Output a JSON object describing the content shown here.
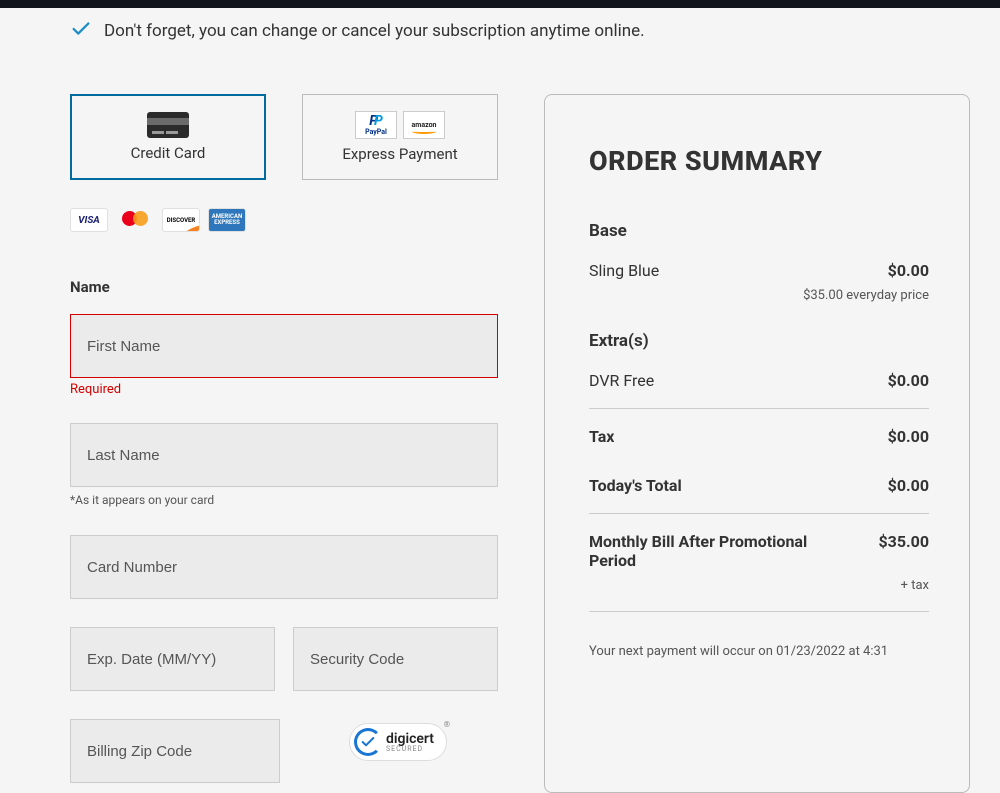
{
  "reminder": {
    "text": "Don't forget, you can change or cancel your subscription anytime online."
  },
  "payment_methods": {
    "credit_card": {
      "label": "Credit Card"
    },
    "express": {
      "label": "Express Payment"
    },
    "paypal_text": "PayPal",
    "amazon_text": "amazon"
  },
  "card_brands": {
    "visa": "VISA",
    "mastercard_hint": "mastercard",
    "discover": "DISCOVER",
    "amex": "AMERICAN EXPRESS"
  },
  "form": {
    "name_section_label": "Name",
    "first_name": {
      "placeholder": "First Name",
      "value": "",
      "error": "Required"
    },
    "last_name": {
      "placeholder": "Last Name",
      "hint": "*As it appears on your card"
    },
    "card_number": {
      "placeholder": "Card Number"
    },
    "exp": {
      "placeholder": "Exp. Date (MM/YY)"
    },
    "cvv": {
      "placeholder": "Security Code"
    },
    "zip": {
      "placeholder": "Billing Zip Code"
    }
  },
  "digicert": {
    "brand": "digicert",
    "sub": "SECURED"
  },
  "summary": {
    "title": "ORDER SUMMARY",
    "base_label": "Base",
    "base_item": {
      "name": "Sling Blue",
      "price": "$0.00",
      "everyday": "$35.00 everyday price"
    },
    "extras_label": "Extra(s)",
    "extra_item": {
      "name": "DVR Free",
      "price": "$0.00"
    },
    "tax": {
      "label": "Tax",
      "price": "$0.00"
    },
    "total": {
      "label": "Today's Total",
      "price": "$0.00"
    },
    "monthly": {
      "label": "Monthly Bill After Promotional Period",
      "price": "$35.00",
      "plus_tax": "+ tax"
    },
    "next_payment": "Your next payment will occur on 01/23/2022 at 4:31"
  }
}
